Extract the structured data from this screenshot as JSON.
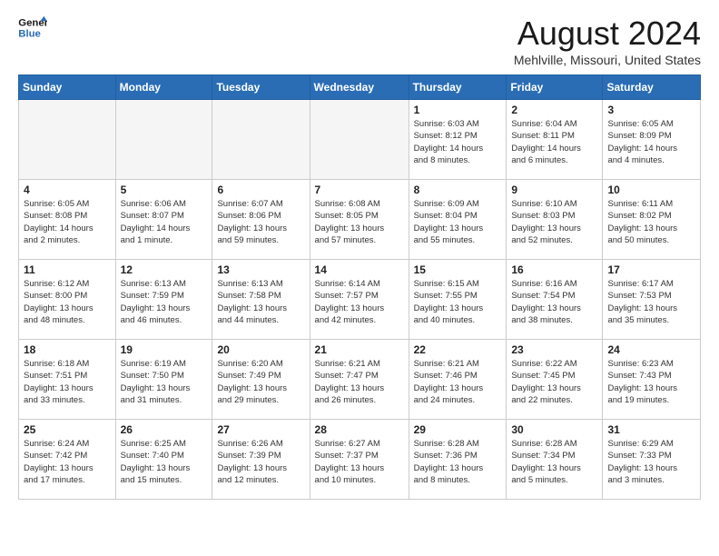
{
  "header": {
    "logo_line1": "General",
    "logo_line2": "Blue",
    "month": "August 2024",
    "location": "Mehlville, Missouri, United States"
  },
  "weekdays": [
    "Sunday",
    "Monday",
    "Tuesday",
    "Wednesday",
    "Thursday",
    "Friday",
    "Saturday"
  ],
  "weeks": [
    [
      {
        "day": "",
        "info": ""
      },
      {
        "day": "",
        "info": ""
      },
      {
        "day": "",
        "info": ""
      },
      {
        "day": "",
        "info": ""
      },
      {
        "day": "1",
        "info": "Sunrise: 6:03 AM\nSunset: 8:12 PM\nDaylight: 14 hours\nand 8 minutes."
      },
      {
        "day": "2",
        "info": "Sunrise: 6:04 AM\nSunset: 8:11 PM\nDaylight: 14 hours\nand 6 minutes."
      },
      {
        "day": "3",
        "info": "Sunrise: 6:05 AM\nSunset: 8:09 PM\nDaylight: 14 hours\nand 4 minutes."
      }
    ],
    [
      {
        "day": "4",
        "info": "Sunrise: 6:05 AM\nSunset: 8:08 PM\nDaylight: 14 hours\nand 2 minutes."
      },
      {
        "day": "5",
        "info": "Sunrise: 6:06 AM\nSunset: 8:07 PM\nDaylight: 14 hours\nand 1 minute."
      },
      {
        "day": "6",
        "info": "Sunrise: 6:07 AM\nSunset: 8:06 PM\nDaylight: 13 hours\nand 59 minutes."
      },
      {
        "day": "7",
        "info": "Sunrise: 6:08 AM\nSunset: 8:05 PM\nDaylight: 13 hours\nand 57 minutes."
      },
      {
        "day": "8",
        "info": "Sunrise: 6:09 AM\nSunset: 8:04 PM\nDaylight: 13 hours\nand 55 minutes."
      },
      {
        "day": "9",
        "info": "Sunrise: 6:10 AM\nSunset: 8:03 PM\nDaylight: 13 hours\nand 52 minutes."
      },
      {
        "day": "10",
        "info": "Sunrise: 6:11 AM\nSunset: 8:02 PM\nDaylight: 13 hours\nand 50 minutes."
      }
    ],
    [
      {
        "day": "11",
        "info": "Sunrise: 6:12 AM\nSunset: 8:00 PM\nDaylight: 13 hours\nand 48 minutes."
      },
      {
        "day": "12",
        "info": "Sunrise: 6:13 AM\nSunset: 7:59 PM\nDaylight: 13 hours\nand 46 minutes."
      },
      {
        "day": "13",
        "info": "Sunrise: 6:13 AM\nSunset: 7:58 PM\nDaylight: 13 hours\nand 44 minutes."
      },
      {
        "day": "14",
        "info": "Sunrise: 6:14 AM\nSunset: 7:57 PM\nDaylight: 13 hours\nand 42 minutes."
      },
      {
        "day": "15",
        "info": "Sunrise: 6:15 AM\nSunset: 7:55 PM\nDaylight: 13 hours\nand 40 minutes."
      },
      {
        "day": "16",
        "info": "Sunrise: 6:16 AM\nSunset: 7:54 PM\nDaylight: 13 hours\nand 38 minutes."
      },
      {
        "day": "17",
        "info": "Sunrise: 6:17 AM\nSunset: 7:53 PM\nDaylight: 13 hours\nand 35 minutes."
      }
    ],
    [
      {
        "day": "18",
        "info": "Sunrise: 6:18 AM\nSunset: 7:51 PM\nDaylight: 13 hours\nand 33 minutes."
      },
      {
        "day": "19",
        "info": "Sunrise: 6:19 AM\nSunset: 7:50 PM\nDaylight: 13 hours\nand 31 minutes."
      },
      {
        "day": "20",
        "info": "Sunrise: 6:20 AM\nSunset: 7:49 PM\nDaylight: 13 hours\nand 29 minutes."
      },
      {
        "day": "21",
        "info": "Sunrise: 6:21 AM\nSunset: 7:47 PM\nDaylight: 13 hours\nand 26 minutes."
      },
      {
        "day": "22",
        "info": "Sunrise: 6:21 AM\nSunset: 7:46 PM\nDaylight: 13 hours\nand 24 minutes."
      },
      {
        "day": "23",
        "info": "Sunrise: 6:22 AM\nSunset: 7:45 PM\nDaylight: 13 hours\nand 22 minutes."
      },
      {
        "day": "24",
        "info": "Sunrise: 6:23 AM\nSunset: 7:43 PM\nDaylight: 13 hours\nand 19 minutes."
      }
    ],
    [
      {
        "day": "25",
        "info": "Sunrise: 6:24 AM\nSunset: 7:42 PM\nDaylight: 13 hours\nand 17 minutes."
      },
      {
        "day": "26",
        "info": "Sunrise: 6:25 AM\nSunset: 7:40 PM\nDaylight: 13 hours\nand 15 minutes."
      },
      {
        "day": "27",
        "info": "Sunrise: 6:26 AM\nSunset: 7:39 PM\nDaylight: 13 hours\nand 12 minutes."
      },
      {
        "day": "28",
        "info": "Sunrise: 6:27 AM\nSunset: 7:37 PM\nDaylight: 13 hours\nand 10 minutes."
      },
      {
        "day": "29",
        "info": "Sunrise: 6:28 AM\nSunset: 7:36 PM\nDaylight: 13 hours\nand 8 minutes."
      },
      {
        "day": "30",
        "info": "Sunrise: 6:28 AM\nSunset: 7:34 PM\nDaylight: 13 hours\nand 5 minutes."
      },
      {
        "day": "31",
        "info": "Sunrise: 6:29 AM\nSunset: 7:33 PM\nDaylight: 13 hours\nand 3 minutes."
      }
    ]
  ]
}
